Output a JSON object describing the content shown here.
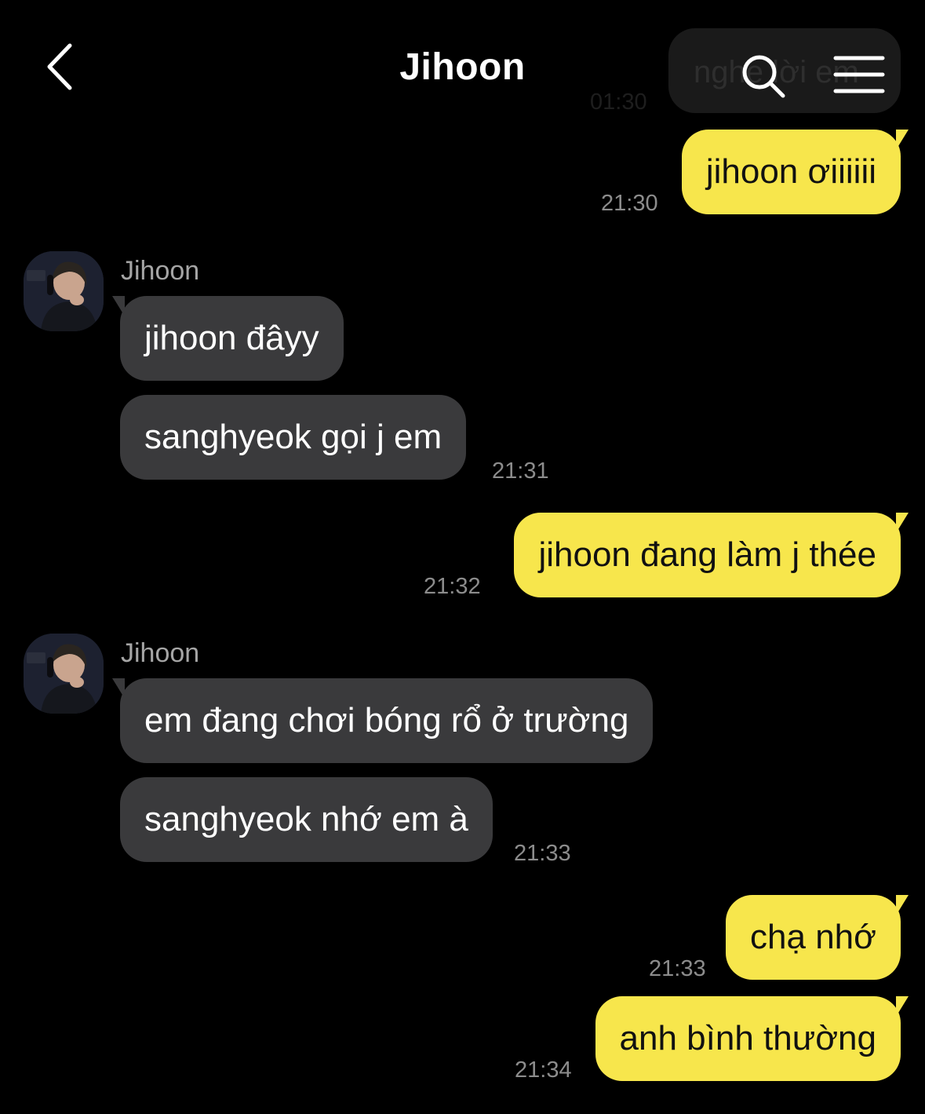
{
  "header": {
    "title": "Jihoon",
    "ghost_message": "nghe lời em",
    "ghost_time": "01:30"
  },
  "messages": [
    {
      "text": "jihoon ơiiiiii",
      "time": "21:30"
    },
    {
      "sender": "Jihoon",
      "text": "jihoon đâyy"
    },
    {
      "text": "sanghyeok gọi j em",
      "time": "21:31"
    },
    {
      "text": "jihoon đang làm j thée",
      "time": "21:32"
    },
    {
      "sender": "Jihoon",
      "text": "em đang chơi bóng rổ ở trường"
    },
    {
      "text": "sanghyeok nhớ em à",
      "time": "21:33"
    },
    {
      "text": "chạ nhớ",
      "time": "21:33"
    },
    {
      "text": "anh bình thường",
      "time": "21:34"
    }
  ],
  "colors": {
    "outgoing_bubble": "#f7e64c",
    "incoming_bubble": "#3a3a3c",
    "background": "#000000"
  },
  "icons": [
    "back-chevron-icon",
    "search-icon",
    "menu-icon"
  ]
}
